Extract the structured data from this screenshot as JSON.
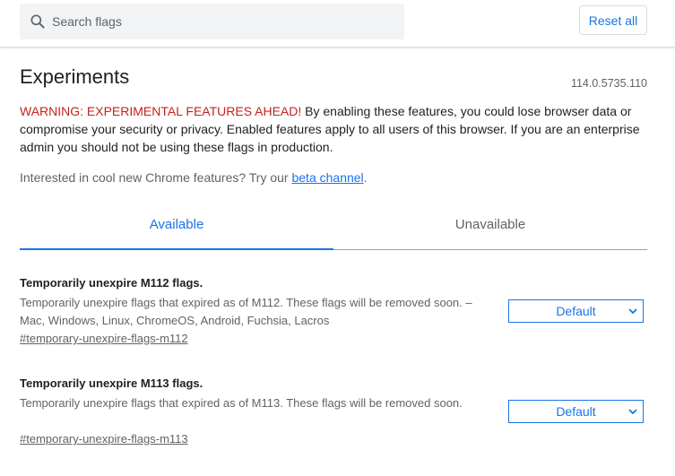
{
  "search": {
    "placeholder": "Search flags",
    "value": ""
  },
  "toolbar": {
    "reset_label": "Reset all"
  },
  "header": {
    "title": "Experiments",
    "version": "114.0.5735.110"
  },
  "warning": {
    "lead": "WARNING: EXPERIMENTAL FEATURES AHEAD!",
    "body": " By enabling these features, you could lose browser data or compromise your security or privacy. Enabled features apply to all users of this browser. If you are an enterprise admin you should not be using these flags in production."
  },
  "interest": {
    "text": "Interested in cool new Chrome features? Try our ",
    "link_label": "beta channel",
    "suffix": "."
  },
  "tabs": [
    {
      "label": "Available",
      "active": true
    },
    {
      "label": "Unavailable",
      "active": false
    }
  ],
  "flags": [
    {
      "title": "Temporarily unexpire M112 flags.",
      "description": "Temporarily unexpire flags that expired as of M112. These flags will be removed soon. – Mac, Windows, Linux, ChromeOS, Android, Fuchsia, Lacros",
      "link": "#temporary-unexpire-flags-m112",
      "selected": "Default"
    },
    {
      "title": "Temporarily unexpire M113 flags.",
      "description": "Temporarily unexpire flags that expired as of M113. These flags will be removed soon.",
      "link": "#temporary-unexpire-flags-m113",
      "selected": "Default"
    }
  ],
  "colors": {
    "accent": "#1a73e8",
    "warning": "#c5221f",
    "secondary_text": "#5f6368"
  },
  "icons": {
    "search": "search-icon",
    "select": "chevron-down-icon"
  }
}
